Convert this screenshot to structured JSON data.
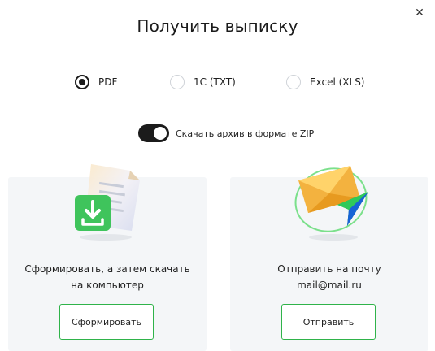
{
  "dialog": {
    "title": "Получить выписку",
    "close_icon": "close-icon"
  },
  "formats": {
    "selected": "PDF",
    "options": [
      {
        "label": "PDF",
        "checked": true
      },
      {
        "label": "1С (TXT)",
        "checked": false
      },
      {
        "label": "Excel (XLS)",
        "checked": false
      }
    ]
  },
  "zip": {
    "label": "Скачать архив в формате ZIP",
    "enabled": true
  },
  "download_card": {
    "text_line1": "Сформировать, а затем скачать",
    "text_line2": "на компьютер",
    "button": "Сформировать",
    "icon": "download-document-icon"
  },
  "email_card": {
    "text_line1": "Отправить на почту",
    "email": "mail@mail.ru",
    "button": "Отправить",
    "icon": "email-send-icon"
  },
  "colors": {
    "accent": "#2fb34a",
    "dark": "#1b1b1b",
    "card_bg": "#f4f6f8"
  }
}
